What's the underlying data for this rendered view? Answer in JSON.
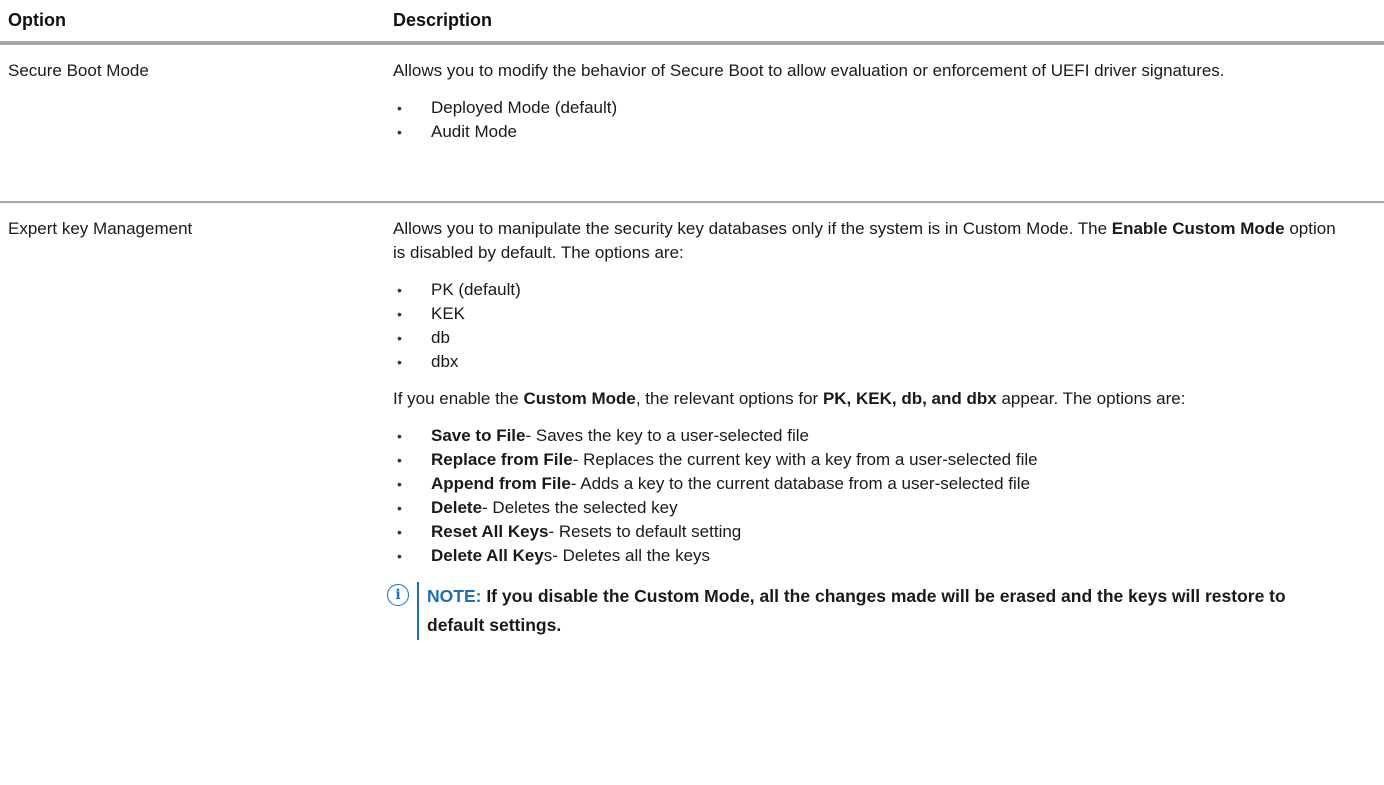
{
  "header": {
    "option": "Option",
    "description": "Description"
  },
  "row1": {
    "option": "Secure Boot Mode",
    "desc": "Allows you to modify the behavior of Secure Boot to allow evaluation or enforcement of UEFI driver signatures.",
    "bullets": [
      "Deployed Mode (default)",
      "Audit Mode"
    ]
  },
  "row2": {
    "option": "Expert key Management",
    "p1_a": "Allows you to manipulate the security key databases only if the system is in Custom Mode. The ",
    "p1_b": "Enable Custom Mode",
    "p1_c": " option is disabled by default. The options are:",
    "bullets1": [
      "PK (default)",
      "KEK",
      "db",
      "dbx"
    ],
    "p2_a": "If you enable the ",
    "p2_b": "Custom Mode",
    "p2_c": ", the relevant options for ",
    "p2_d": "PK, KEK, db, and dbx",
    "p2_e": " appear. The options are:",
    "bullets2": [
      {
        "bold": "Save to File",
        "rest": "- Saves the key to a user-selected file"
      },
      {
        "bold": "Replace from File",
        "rest": "- Replaces the current key with a key from a user-selected file"
      },
      {
        "bold": "Append from File",
        "rest": "- Adds a key to the current database from a user-selected file"
      },
      {
        "bold": "Delete",
        "rest": "- Deletes the selected key"
      },
      {
        "bold": "Reset All Keys",
        "rest": "- Resets to default setting"
      },
      {
        "bold": "Delete All Key",
        "rest": "s- Deletes all the keys"
      }
    ],
    "note_label": "NOTE:",
    "note_text": " If you disable the Custom Mode, all the changes made will be erased and the keys will restore to default settings."
  },
  "bullet_char": "•",
  "icons": {
    "note": "info-icon"
  },
  "colors": {
    "note_accent": "#1e6fb5",
    "rule": "#a6a6a6"
  }
}
